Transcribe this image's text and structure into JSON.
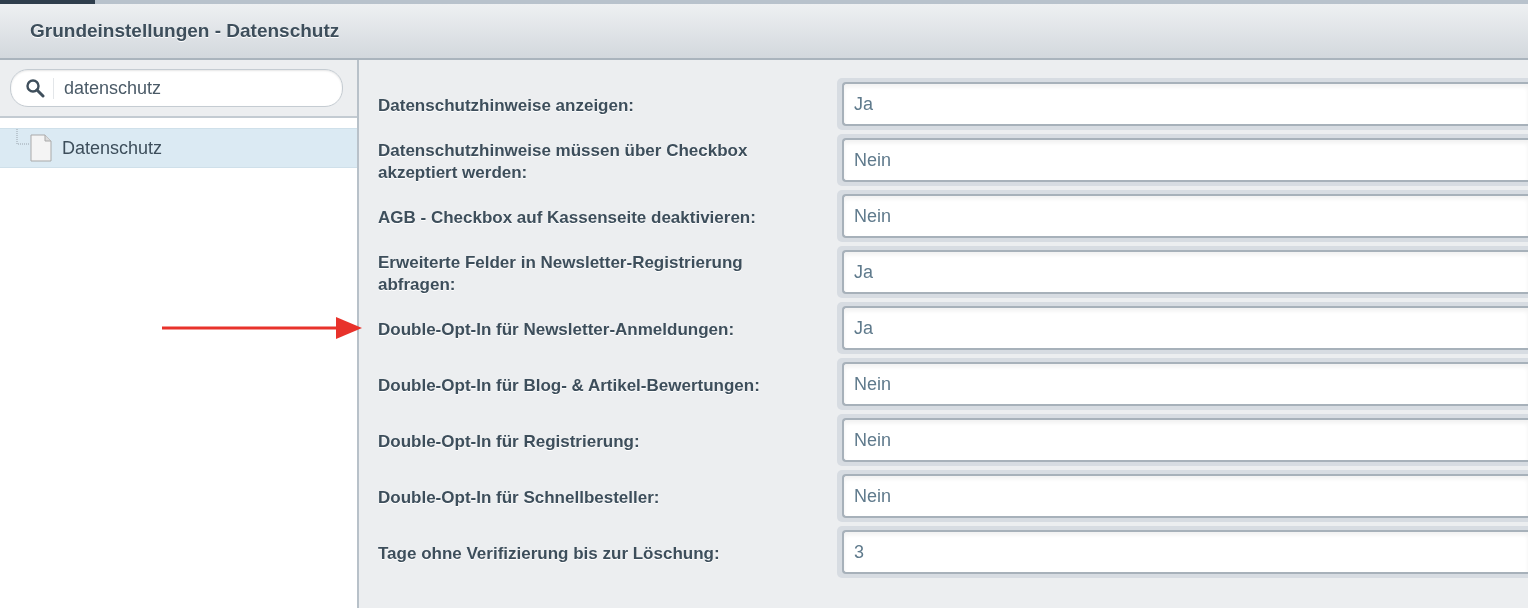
{
  "window": {
    "title": "Grundeinstellungen - Datenschutz"
  },
  "sidebar": {
    "search": {
      "value": "datenschutz"
    },
    "tree": [
      {
        "label": "Datenschutz",
        "selected": true
      }
    ]
  },
  "settings": [
    {
      "label": "Datenschutzhinweise anzeigen:",
      "value": "Ja",
      "marked": false
    },
    {
      "label": "Datenschutzhinweise müssen über Checkbox akzeptiert werden:",
      "value": "Nein",
      "marked": false
    },
    {
      "label": "AGB - Checkbox auf Kassenseite deaktivieren:",
      "value": "Nein",
      "marked": false
    },
    {
      "label": "Erweiterte Felder in Newsletter-Registrierung abfragen:",
      "value": "Ja",
      "marked": false
    },
    {
      "label": "Double-Opt-In für Newsletter-Anmeldungen:",
      "value": "Ja",
      "marked": true
    },
    {
      "label": "Double-Opt-In für Blog- & Artikel-Bewertungen:",
      "value": "Nein",
      "marked": false
    },
    {
      "label": "Double-Opt-In für Registrierung:",
      "value": "Nein",
      "marked": false
    },
    {
      "label": "Double-Opt-In für Schnellbesteller:",
      "value": "Nein",
      "marked": false
    },
    {
      "label": "Tage ohne Verifizierung bis zur Löschung:",
      "value": "3",
      "marked": false
    }
  ]
}
